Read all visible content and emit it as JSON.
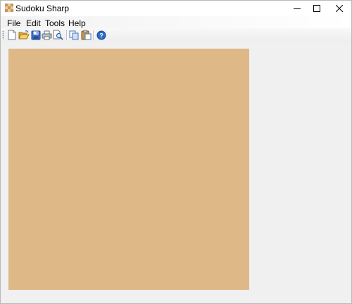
{
  "window": {
    "title": "Sudoku Sharp"
  },
  "menu": {
    "file": "File",
    "edit": "Edit",
    "tools": "Tools",
    "help": "Help"
  },
  "toolbar": {
    "buttons": [
      {
        "icon": "new-document-icon"
      },
      {
        "icon": "open-folder-icon"
      },
      {
        "icon": "save-icon"
      },
      {
        "icon": "print-icon"
      },
      {
        "icon": "print-preview-icon"
      },
      {
        "icon": "copy-icon"
      },
      {
        "icon": "paste-icon"
      },
      {
        "icon": "help-icon"
      }
    ]
  },
  "colors": {
    "board": "#deb887",
    "client_background": "#f0f0f0",
    "accent_blue": "#2b6cc4"
  }
}
